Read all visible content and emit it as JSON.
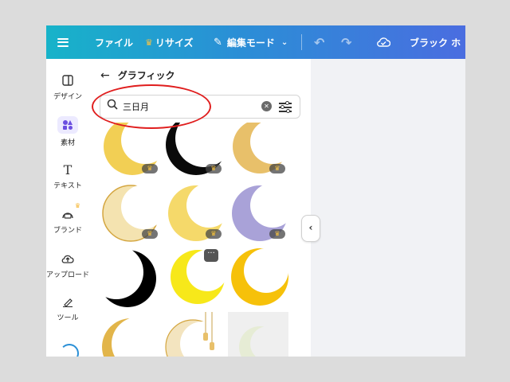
{
  "topbar": {
    "file": "ファイル",
    "resize": "リサイズ",
    "edit_mode": "編集モード",
    "brand": "ブラック ホ"
  },
  "rail": [
    {
      "label": "デザイン",
      "icon": "layout-icon"
    },
    {
      "label": "素材",
      "icon": "elements-icon",
      "active": true
    },
    {
      "label": "テキスト",
      "icon": "text-icon"
    },
    {
      "label": "ブランド",
      "icon": "brand-icon",
      "premium": true
    },
    {
      "label": "アップロード",
      "icon": "upload-icon"
    },
    {
      "label": "ツール",
      "icon": "tools-icon"
    }
  ],
  "panel": {
    "title": "グラフィック",
    "search": {
      "value": "三日月",
      "placeholder": ""
    }
  },
  "colors": {
    "accent": "#6b4fe0",
    "annotation": "#e01e1e",
    "crown": "#f6c343"
  },
  "graphics": [
    {
      "name": "gold-crescent",
      "premium": true
    },
    {
      "name": "black-crescent",
      "premium": true
    },
    {
      "name": "watercolor-gold-crescent",
      "premium": true
    },
    {
      "name": "ornate-gold-crescent",
      "premium": true
    },
    {
      "name": "light-yellow-crescent",
      "premium": true
    },
    {
      "name": "purple-watercolor-crescent",
      "premium": true
    },
    {
      "name": "solid-black-crescent",
      "premium": false
    },
    {
      "name": "bright-yellow-crescent",
      "premium": false,
      "more": true
    },
    {
      "name": "amber-crescent",
      "premium": false
    },
    {
      "name": "gold-thin-crescent",
      "premium": false
    },
    {
      "name": "lantern-crescent",
      "premium": false
    },
    {
      "name": "pale-crescent",
      "premium": false
    }
  ]
}
